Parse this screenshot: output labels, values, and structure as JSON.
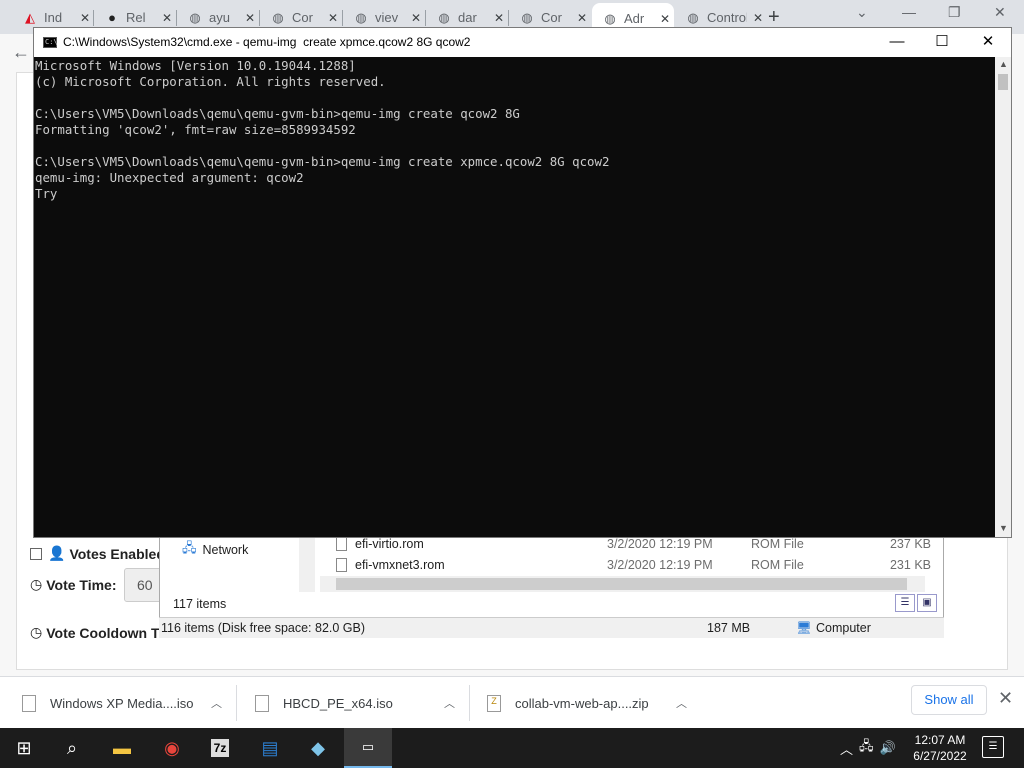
{
  "browser": {
    "tabs": [
      {
        "label": "Ind",
        "icon": "acrobat-icon"
      },
      {
        "label": "Rel",
        "icon": "github-icon"
      },
      {
        "label": "ayu",
        "icon": "globe-icon"
      },
      {
        "label": "Cor",
        "icon": "globe-icon"
      },
      {
        "label": "viev",
        "icon": "globe-icon"
      },
      {
        "label": "dar",
        "icon": "globe-icon"
      },
      {
        "label": "Cor",
        "icon": "globe-icon"
      },
      {
        "label": "Adr",
        "icon": "globe-icon"
      },
      {
        "label": "Control",
        "icon": "globe-icon"
      }
    ],
    "active_tab_index": 7
  },
  "page": {
    "votes_enabled_label": "Votes Enabled",
    "vote_time_label": "Vote Time:",
    "vote_time_value": "60",
    "vote_cooldown_label": "Vote Cooldown T"
  },
  "explorer": {
    "nav_item": "Network",
    "files": [
      {
        "name": "efi-virtio.rom",
        "date": "3/2/2020 12:19 PM",
        "type": "ROM File",
        "size": "237 KB"
      },
      {
        "name": "efi-vmxnet3.rom",
        "date": "3/2/2020 12:19 PM",
        "type": "ROM File",
        "size": "231 KB"
      }
    ],
    "item_count": "117 items",
    "status_items": "116 items (Disk free space: 82.0 GB)",
    "status_size": "187 MB",
    "status_location": "Computer"
  },
  "cmd": {
    "title": "C:\\Windows\\System32\\cmd.exe - qemu-img  create xpmce.qcow2 8G qcow2",
    "lines": [
      "Microsoft Windows [Version 10.0.19044.1288]",
      "(c) Microsoft Corporation. All rights reserved.",
      "",
      "C:\\Users\\VM5\\Downloads\\qemu\\qemu-gvm-bin>qemu-img create qcow2 8G",
      "Formatting 'qcow2', fmt=raw size=8589934592",
      "",
      "C:\\Users\\VM5\\Downloads\\qemu\\qemu-gvm-bin>qemu-img create xpmce.qcow2 8G qcow2",
      "qemu-img: Unexpected argument: qcow2",
      "Try"
    ]
  },
  "downloads": {
    "items": [
      {
        "name": "Windows XP Media....iso"
      },
      {
        "name": "HBCD_PE_x64.iso"
      },
      {
        "name": "collab-vm-web-ap....zip"
      }
    ],
    "show_all": "Show all"
  },
  "taskbar": {
    "time": "12:07 AM",
    "date": "6/27/2022",
    "accent": "#76b9ed"
  }
}
